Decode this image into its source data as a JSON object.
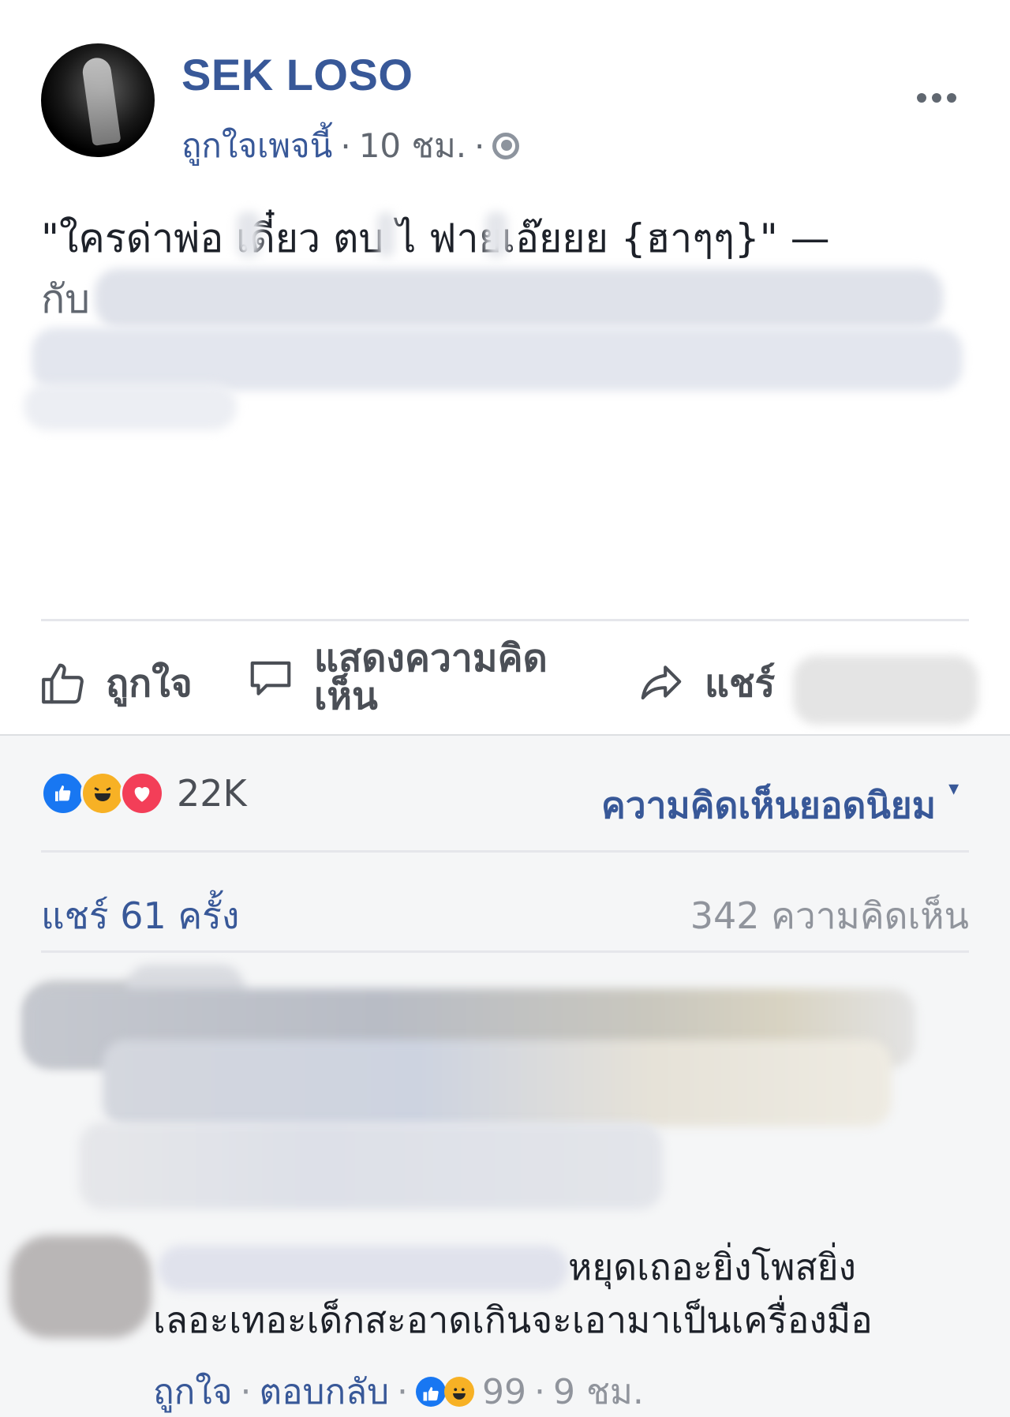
{
  "post": {
    "author": "SEK LOSO",
    "like_page": "ถูกใจเพจนี้",
    "dot1": "·",
    "time": "10 ชม.",
    "dot2": "·",
    "text": "\"ใครด่าพ่อ เดี๋ยว ตบ ไ ฟายเอ๊ยยย {ฮาๆๆ}\" —",
    "with": "กับ"
  },
  "actions": {
    "like": "ถูกใจ",
    "comment": "แสดงความคิดเห็น",
    "share": "แชร์"
  },
  "feedback": {
    "reaction_count": "22K",
    "top_comments": "ความคิดเห็นยอดนิยม",
    "shares": "แชร์ 61 ครั้ง",
    "comments": "342 ความคิดเห็น"
  },
  "comment2": {
    "line1": "หยุดเถอะยิ่งโพสยิ่ง",
    "line2": "เลอะเทอะเด็กสะอาดเกินจะเอามาเป็นเครื่องมือ",
    "like": "ถูกใจ",
    "reply": "ตอบกลับ",
    "reaction_count": "99",
    "time": "9 ชม.",
    "sep": "·"
  },
  "icons": [
    "globe-icon",
    "more-icon",
    "like-icon",
    "comment-icon",
    "share-icon",
    "like-reaction-icon",
    "haha-reaction-icon",
    "love-reaction-icon"
  ],
  "colors": {
    "brand": "#385898",
    "meta": "#616770",
    "feedback_bg": "#f5f6f7"
  }
}
